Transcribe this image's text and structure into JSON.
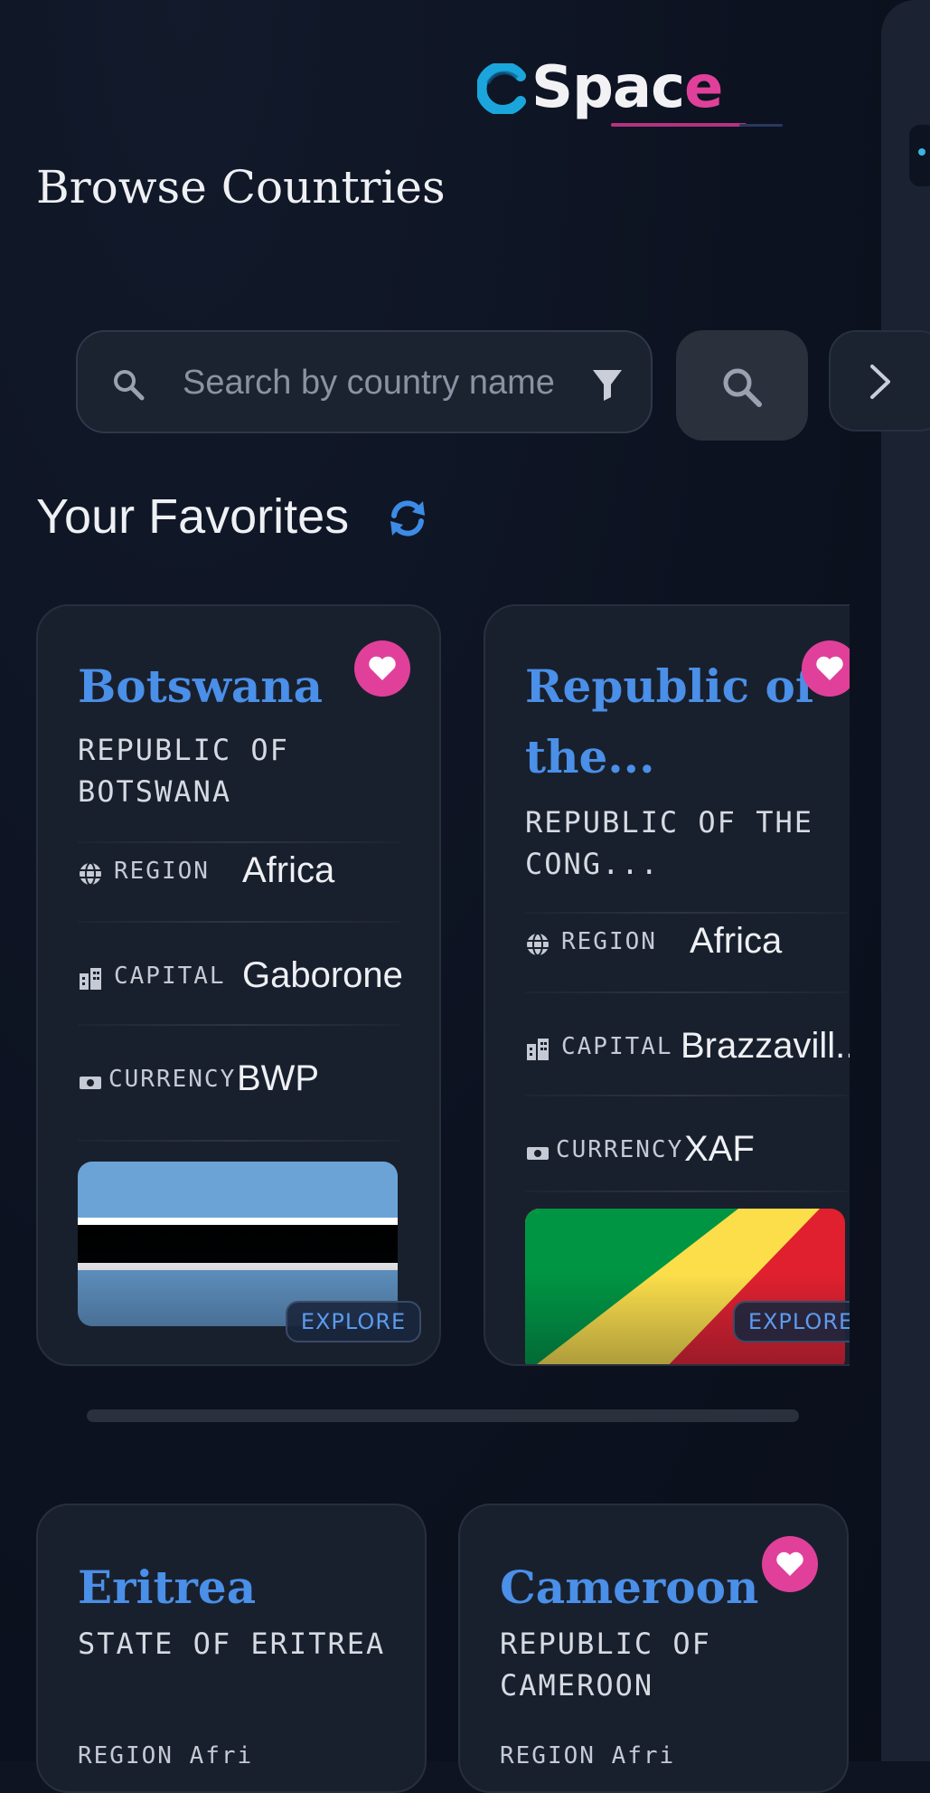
{
  "app": {
    "logo": {
      "prefix": "Spac",
      "accent": "e"
    },
    "page_title": "Browse Countries"
  },
  "search": {
    "placeholder": "Search by country name"
  },
  "favorites": {
    "title": "Your Favorites",
    "explore_label": "EXPLORE",
    "labels": {
      "region": "REGION",
      "capital": "CAPITAL",
      "currency": "CURRENCY"
    },
    "cards": [
      {
        "name": "Botswana",
        "official": "REPUBLIC OF BOTSWANA",
        "region": "Africa",
        "capital": "Gaborone",
        "currency": "BWP",
        "favorite": true
      },
      {
        "name": "Republic of the...",
        "official": "REPUBLIC OF THE CONG...",
        "region": "Africa",
        "capital": "Brazzavill...",
        "currency": "XAF",
        "favorite": true
      }
    ]
  },
  "grid": {
    "cards": [
      {
        "name": "Eritrea",
        "official": "STATE OF ERITREA",
        "region_partial": "REGION  Afri",
        "favorite": false
      },
      {
        "name": "Cameroon",
        "official": "REPUBLIC OF CAMEROON",
        "region_partial": "REGION  Afri",
        "favorite": true
      }
    ]
  },
  "colors": {
    "accent_blue": "#4a8fe8",
    "accent_pink": "#e0409a",
    "background": "#0e1421",
    "card": "#19202d"
  }
}
